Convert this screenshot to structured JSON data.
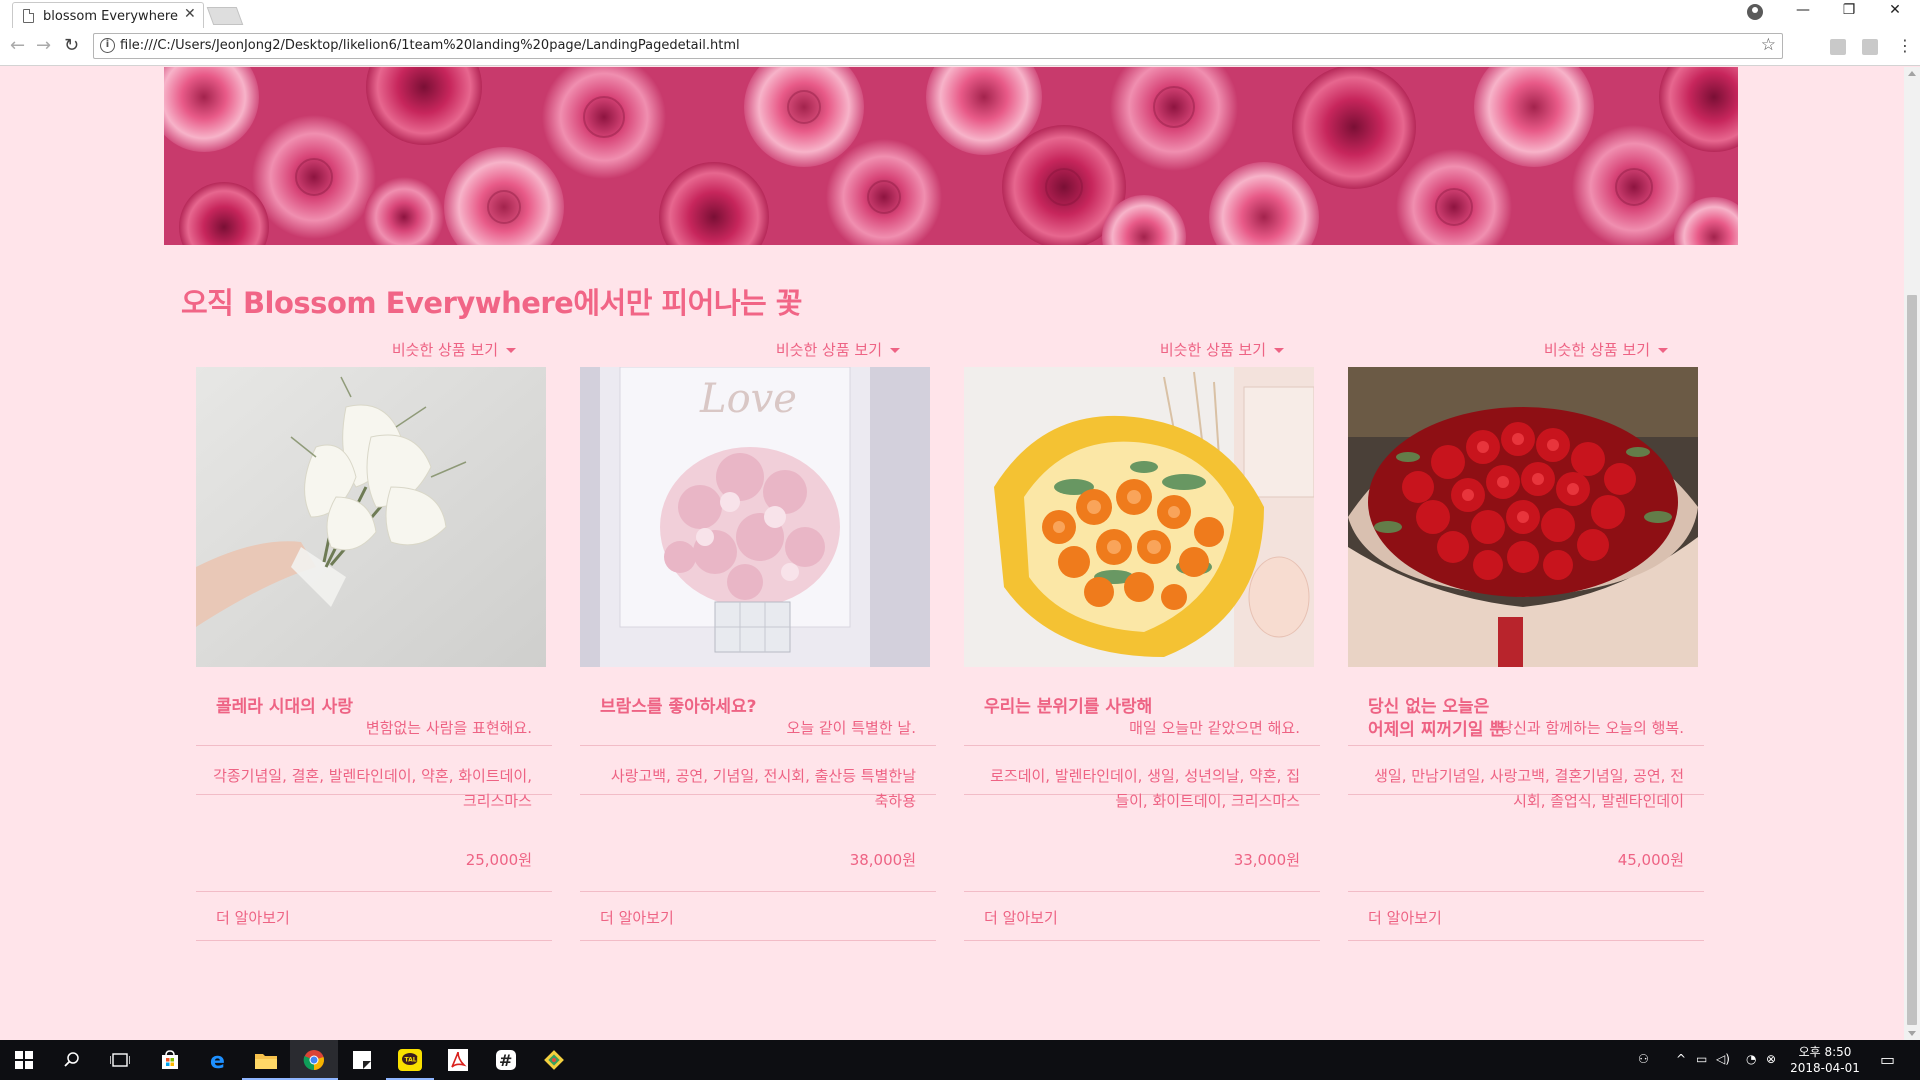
{
  "browser": {
    "tab_title": "blossom Everywhere",
    "url": "file:///C:/Users/JeonJong2/Desktop/likelion6/1team%20landing%20page/LandingPagedetail.html",
    "tab_close": "✕",
    "back": "←",
    "forward": "→",
    "reload": "↻",
    "info": "i",
    "star": "☆",
    "menu": "⋮",
    "window_controls": {
      "minimize": "—",
      "restore": "❐",
      "close": "✕"
    }
  },
  "page": {
    "section_title": "오직 Blossom Everywhere에서만 피어나는 꽃",
    "products": [
      {
        "similar_label": "비슷한 상품 보기",
        "title": "콜레라 시대의 사랑",
        "description": "변함없는 사람을 표현해요.",
        "occasions": "각종기념일, 결혼, 발렌타인데이, 약혼, 화이트데이, 크리스마스",
        "price": "25,000원",
        "more_label": "더 알아보기",
        "image": "white-calla-lily-bouquet"
      },
      {
        "similar_label": "비슷한 상품 보기",
        "title": "브람스를 좋아하세요?",
        "description": "오늘 같이 특별한 날.",
        "occasions": "사랑고백, 공연, 기념일, 전시회, 출산등 특별한날 축하용",
        "price": "38,000원",
        "more_label": "더 알아보기",
        "image": "pink-hydrangea-vase"
      },
      {
        "similar_label": "비슷한 상품 보기",
        "title": "우리는 분위기를 사랑해",
        "description": "매일 오늘만 같았으면 해요.",
        "occasions": "로즈데이, 발렌타인데이, 생일, 성년의날, 약혼, 집들이, 화이트데이, 크리스마스",
        "price": "33,000원",
        "more_label": "더 알아보기",
        "image": "orange-rose-bouquet"
      },
      {
        "similar_label": "비슷한 상품 보기",
        "title": "당신 없는 오늘은\n어제의 찌꺼기일 뿐",
        "description": "당신과 함께하는 오늘의 행복.",
        "occasions": "생일, 만남기념일, 사랑고백, 결혼기념일, 공연, 전시회, 졸업식, 발렌타인데이",
        "price": "45,000원",
        "more_label": "더 알아보기",
        "image": "red-rose-bouquet"
      }
    ]
  },
  "taskbar": {
    "time": "오후 8:50",
    "date": "2018-04-01",
    "apps": [
      "windows-start",
      "search",
      "task-view",
      "store",
      "edge",
      "file-explorer",
      "chrome",
      "sticky-notes",
      "kakaotalk",
      "acrobat",
      "slack",
      "git"
    ]
  },
  "colors": {
    "page_bg": "#ffe4ea",
    "accent": "#ee6384",
    "title": "#f16586"
  }
}
